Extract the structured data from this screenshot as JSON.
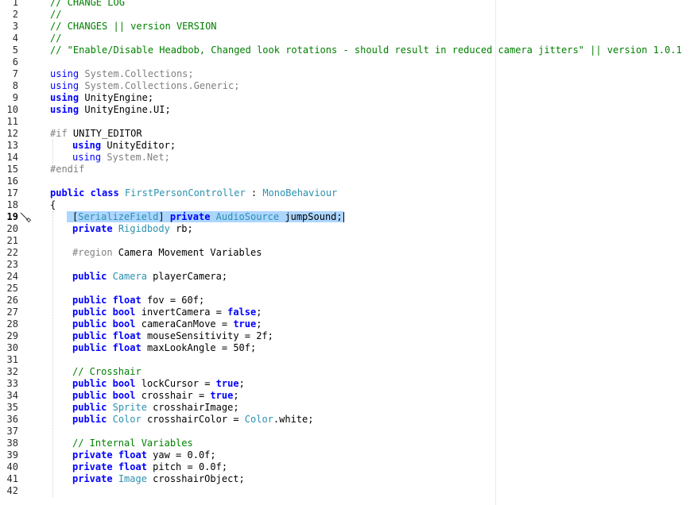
{
  "editor": {
    "active_line": 19,
    "lines": [
      {
        "n": 1,
        "i": 0,
        "t": [
          {
            "s": "// CHANGE LOG",
            "c": "comment"
          }
        ]
      },
      {
        "n": 2,
        "i": 0,
        "t": [
          {
            "s": "//",
            "c": "comment"
          }
        ]
      },
      {
        "n": 3,
        "i": 0,
        "t": [
          {
            "s": "// CHANGES || version VERSION",
            "c": "comment"
          }
        ]
      },
      {
        "n": 4,
        "i": 0,
        "t": [
          {
            "s": "//",
            "c": "comment"
          }
        ]
      },
      {
        "n": 5,
        "i": 0,
        "t": [
          {
            "s": "// \"Enable/Disable Headbob, Changed look rotations - should result in reduced camera jitters\" || version 1.0.1",
            "c": "comment"
          }
        ]
      },
      {
        "n": 6,
        "i": 0,
        "t": []
      },
      {
        "n": 7,
        "i": 0,
        "t": [
          {
            "s": "using",
            "c": "kw"
          },
          {
            "s": " System.Collections;",
            "c": "gray"
          }
        ]
      },
      {
        "n": 8,
        "i": 0,
        "t": [
          {
            "s": "using",
            "c": "kw"
          },
          {
            "s": " System.Collections.Generic;",
            "c": "gray"
          }
        ]
      },
      {
        "n": 9,
        "i": 0,
        "t": [
          {
            "s": "using",
            "c": "kwb"
          },
          {
            "s": " UnityEngine;",
            "c": "plain"
          }
        ]
      },
      {
        "n": 10,
        "i": 0,
        "t": [
          {
            "s": "using",
            "c": "kwb"
          },
          {
            "s": " UnityEngine.UI;",
            "c": "plain"
          }
        ]
      },
      {
        "n": 11,
        "i": 0,
        "t": []
      },
      {
        "n": 12,
        "i": 0,
        "t": [
          {
            "s": "#if",
            "c": "pre"
          },
          {
            "s": " UNITY_EDITOR",
            "c": "plain"
          }
        ]
      },
      {
        "n": 13,
        "i": 1,
        "t": [
          {
            "s": "using",
            "c": "kwb"
          },
          {
            "s": " UnityEditor;",
            "c": "plain"
          }
        ]
      },
      {
        "n": 14,
        "i": 1,
        "t": [
          {
            "s": "using",
            "c": "kw"
          },
          {
            "s": " System.Net;",
            "c": "gray"
          }
        ]
      },
      {
        "n": 15,
        "i": 0,
        "t": [
          {
            "s": "#endif",
            "c": "pre"
          }
        ]
      },
      {
        "n": 16,
        "i": 0,
        "t": []
      },
      {
        "n": 17,
        "i": 0,
        "t": [
          {
            "s": "public",
            "c": "kwb"
          },
          {
            "s": " ",
            "c": "plain"
          },
          {
            "s": "class",
            "c": "kwb"
          },
          {
            "s": " ",
            "c": "plain"
          },
          {
            "s": "FirstPersonController",
            "c": "type"
          },
          {
            "s": " : ",
            "c": "plain"
          },
          {
            "s": "MonoBehaviour",
            "c": "type"
          }
        ]
      },
      {
        "n": 18,
        "i": 0,
        "t": [
          {
            "s": "{",
            "c": "plain"
          }
        ]
      },
      {
        "n": 19,
        "i": 1,
        "sel": true,
        "t": [
          {
            "s": "[",
            "c": "plain"
          },
          {
            "s": "SerializeField",
            "c": "type"
          },
          {
            "s": "] ",
            "c": "plain"
          },
          {
            "s": "private",
            "c": "kwb"
          },
          {
            "s": " ",
            "c": "plain"
          },
          {
            "s": "AudioSource",
            "c": "type"
          },
          {
            "s": " jumpSound;",
            "c": "plain"
          }
        ]
      },
      {
        "n": 20,
        "i": 1,
        "t": [
          {
            "s": "private",
            "c": "kwb"
          },
          {
            "s": " ",
            "c": "plain"
          },
          {
            "s": "Rigidbody",
            "c": "type"
          },
          {
            "s": " rb;",
            "c": "plain"
          }
        ]
      },
      {
        "n": 21,
        "i": 1,
        "t": []
      },
      {
        "n": 22,
        "i": 1,
        "t": [
          {
            "s": "#region",
            "c": "pre"
          },
          {
            "s": " Camera Movement Variables",
            "c": "plain"
          }
        ]
      },
      {
        "n": 23,
        "i": 1,
        "t": []
      },
      {
        "n": 24,
        "i": 1,
        "t": [
          {
            "s": "public",
            "c": "kwb"
          },
          {
            "s": " ",
            "c": "plain"
          },
          {
            "s": "Camera",
            "c": "type"
          },
          {
            "s": " playerCamera;",
            "c": "plain"
          }
        ]
      },
      {
        "n": 25,
        "i": 1,
        "t": []
      },
      {
        "n": 26,
        "i": 1,
        "t": [
          {
            "s": "public",
            "c": "kwb"
          },
          {
            "s": " ",
            "c": "plain"
          },
          {
            "s": "float",
            "c": "kwb"
          },
          {
            "s": " fov = 60f;",
            "c": "plain"
          }
        ]
      },
      {
        "n": 27,
        "i": 1,
        "t": [
          {
            "s": "public",
            "c": "kwb"
          },
          {
            "s": " ",
            "c": "plain"
          },
          {
            "s": "bool",
            "c": "kwb"
          },
          {
            "s": " invertCamera = ",
            "c": "plain"
          },
          {
            "s": "false",
            "c": "kwb"
          },
          {
            "s": ";",
            "c": "plain"
          }
        ]
      },
      {
        "n": 28,
        "i": 1,
        "t": [
          {
            "s": "public",
            "c": "kwb"
          },
          {
            "s": " ",
            "c": "plain"
          },
          {
            "s": "bool",
            "c": "kwb"
          },
          {
            "s": " cameraCanMove = ",
            "c": "plain"
          },
          {
            "s": "true",
            "c": "kwb"
          },
          {
            "s": ";",
            "c": "plain"
          }
        ]
      },
      {
        "n": 29,
        "i": 1,
        "t": [
          {
            "s": "public",
            "c": "kwb"
          },
          {
            "s": " ",
            "c": "plain"
          },
          {
            "s": "float",
            "c": "kwb"
          },
          {
            "s": " mouseSensitivity = 2f;",
            "c": "plain"
          }
        ]
      },
      {
        "n": 30,
        "i": 1,
        "t": [
          {
            "s": "public",
            "c": "kwb"
          },
          {
            "s": " ",
            "c": "plain"
          },
          {
            "s": "float",
            "c": "kwb"
          },
          {
            "s": " maxLookAngle = 50f;",
            "c": "plain"
          }
        ]
      },
      {
        "n": 31,
        "i": 1,
        "t": []
      },
      {
        "n": 32,
        "i": 1,
        "t": [
          {
            "s": "// Crosshair",
            "c": "comment"
          }
        ]
      },
      {
        "n": 33,
        "i": 1,
        "t": [
          {
            "s": "public",
            "c": "kwb"
          },
          {
            "s": " ",
            "c": "plain"
          },
          {
            "s": "bool",
            "c": "kwb"
          },
          {
            "s": " lockCursor = ",
            "c": "plain"
          },
          {
            "s": "true",
            "c": "kwb"
          },
          {
            "s": ";",
            "c": "plain"
          }
        ]
      },
      {
        "n": 34,
        "i": 1,
        "t": [
          {
            "s": "public",
            "c": "kwb"
          },
          {
            "s": " ",
            "c": "plain"
          },
          {
            "s": "bool",
            "c": "kwb"
          },
          {
            "s": " crosshair = ",
            "c": "plain"
          },
          {
            "s": "true",
            "c": "kwb"
          },
          {
            "s": ";",
            "c": "plain"
          }
        ]
      },
      {
        "n": 35,
        "i": 1,
        "t": [
          {
            "s": "public",
            "c": "kwb"
          },
          {
            "s": " ",
            "c": "plain"
          },
          {
            "s": "Sprite",
            "c": "type"
          },
          {
            "s": " crosshairImage;",
            "c": "plain"
          }
        ]
      },
      {
        "n": 36,
        "i": 1,
        "t": [
          {
            "s": "public",
            "c": "kwb"
          },
          {
            "s": " ",
            "c": "plain"
          },
          {
            "s": "Color",
            "c": "type"
          },
          {
            "s": " crosshairColor = ",
            "c": "plain"
          },
          {
            "s": "Color",
            "c": "type"
          },
          {
            "s": ".white;",
            "c": "plain"
          }
        ]
      },
      {
        "n": 37,
        "i": 1,
        "t": []
      },
      {
        "n": 38,
        "i": 1,
        "t": [
          {
            "s": "// Internal Variables",
            "c": "comment"
          }
        ]
      },
      {
        "n": 39,
        "i": 1,
        "t": [
          {
            "s": "private",
            "c": "kwb"
          },
          {
            "s": " ",
            "c": "plain"
          },
          {
            "s": "float",
            "c": "kwb"
          },
          {
            "s": " yaw = 0.0f;",
            "c": "plain"
          }
        ]
      },
      {
        "n": 40,
        "i": 1,
        "t": [
          {
            "s": "private",
            "c": "kwb"
          },
          {
            "s": " ",
            "c": "plain"
          },
          {
            "s": "float",
            "c": "kwb"
          },
          {
            "s": " pitch = 0.0f;",
            "c": "plain"
          }
        ]
      },
      {
        "n": 41,
        "i": 1,
        "t": [
          {
            "s": "private",
            "c": "kwb"
          },
          {
            "s": " ",
            "c": "plain"
          },
          {
            "s": "Image",
            "c": "type"
          },
          {
            "s": " crosshairObject;",
            "c": "plain"
          }
        ]
      },
      {
        "n": 42,
        "i": 1,
        "t": []
      }
    ],
    "colors": {
      "comment": "#008000",
      "keyword": "#0000ff",
      "type": "#2b91af",
      "selection": "#add6ff"
    },
    "gutter_icon": "quick-action-brush-icon"
  }
}
